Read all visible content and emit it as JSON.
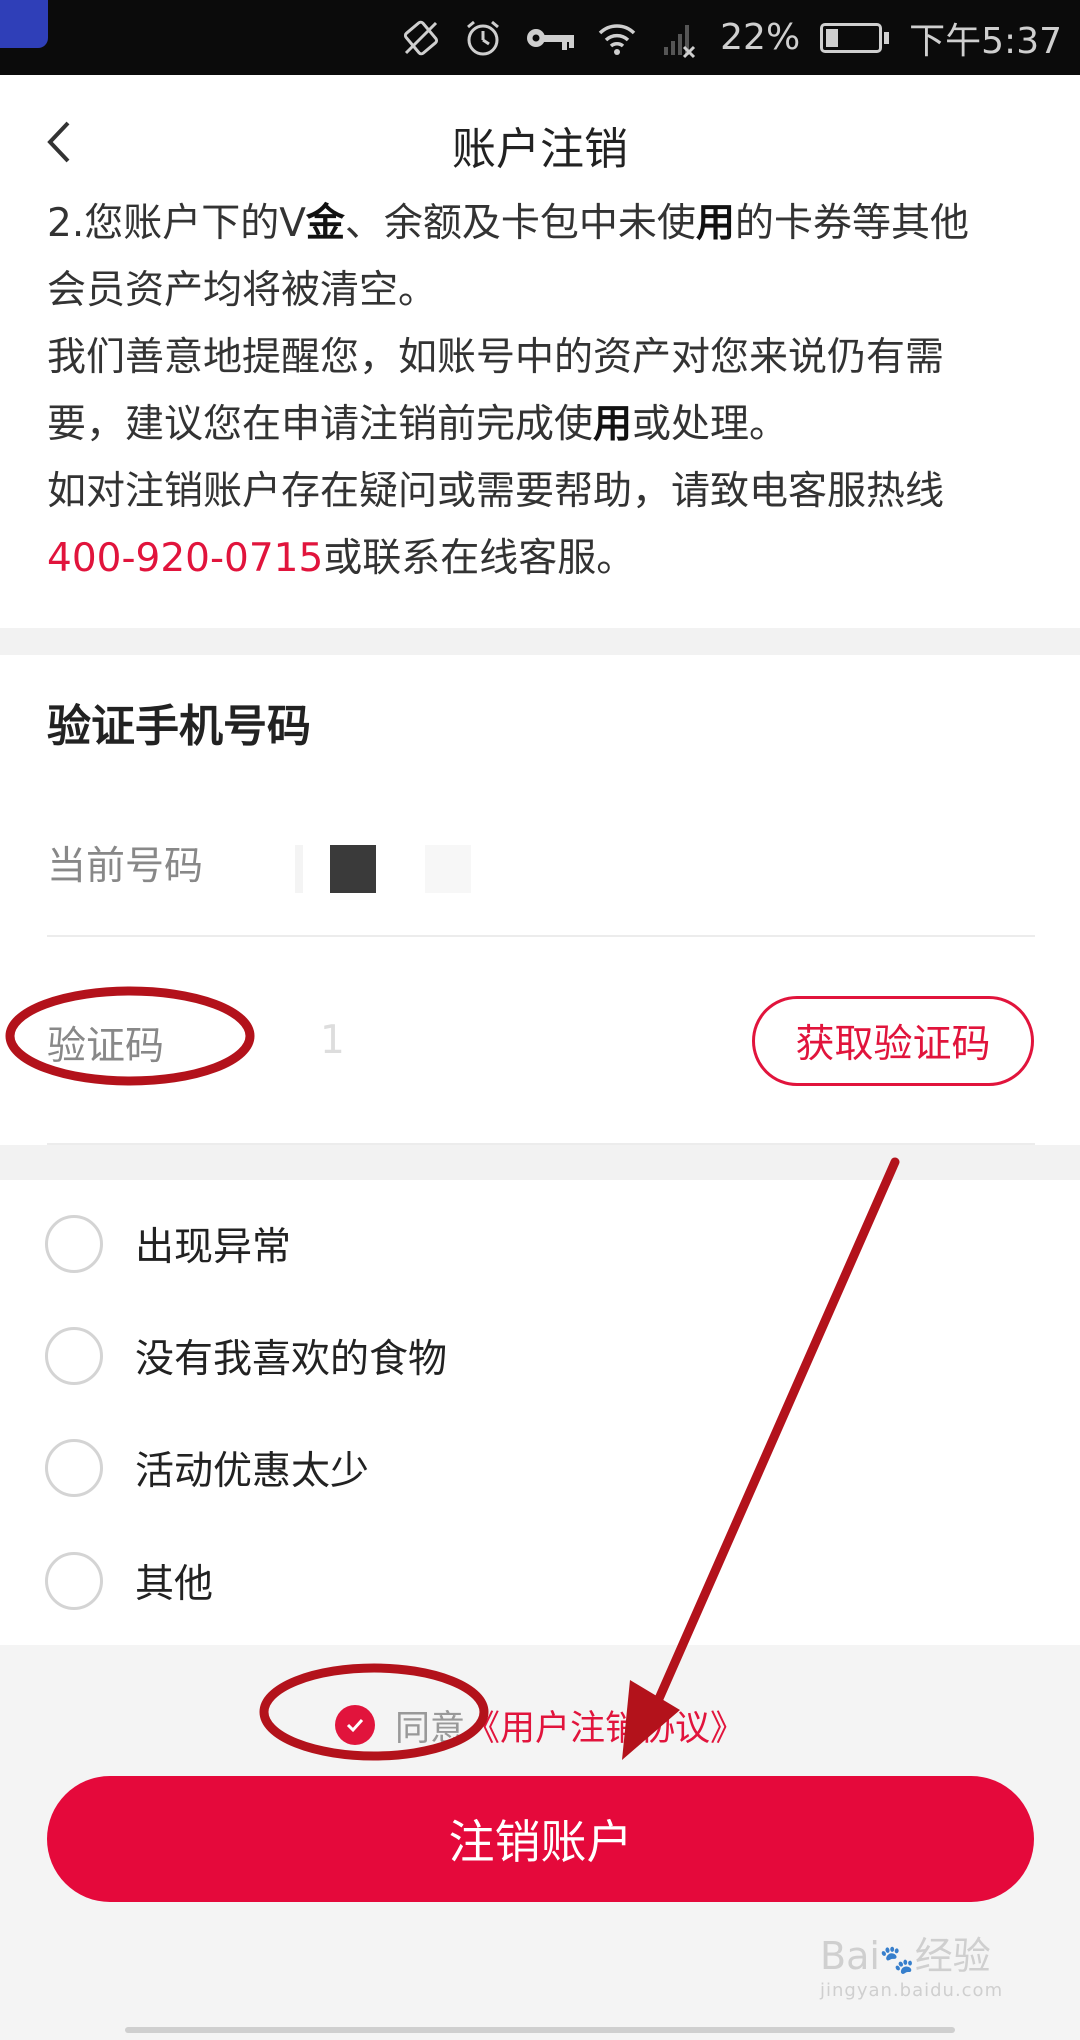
{
  "status_bar": {
    "battery": "22%",
    "time": "下午5:37",
    "icons": [
      "auto-rotate-icon",
      "alarm-icon",
      "key-icon",
      "wifi-icon",
      "signal-icon",
      "battery-icon"
    ]
  },
  "header": {
    "title": "账户注销",
    "back_icon": "chevron-left-icon"
  },
  "notice": {
    "line1_a": "2.您账户下的V",
    "line1_b": "金",
    "line1_c": "、余额及卡包中未使",
    "line1_d": "用",
    "line1_e": "的卡券等其他",
    "line2": "会员资产均将被清空。",
    "line3": "我们善意地提醒您，如账号中的资产对您来说仍有需",
    "line4_a": "要，建议您在申请注销前完成使",
    "line4_b": "用",
    "line4_c": "或处理。",
    "line5": "如对注销账户存在疑问或需要帮助，请致电客服热线",
    "hotline": "400-920-0715",
    "line6_tail": "或联系在线客服。"
  },
  "verify": {
    "title": "验证手机号码",
    "current_number_label": "当前号码",
    "code_label": "验证码",
    "code_value": "1",
    "get_code_button": "获取验证码"
  },
  "reasons": [
    {
      "label": "出现异常"
    },
    {
      "label": "没有我喜欢的食物"
    },
    {
      "label": "活动优惠太少"
    },
    {
      "label": "其他"
    }
  ],
  "agreement": {
    "agree_text": "同意",
    "link_text": "《用户注销协议》",
    "checked": true
  },
  "cancel_button": "注销账户",
  "watermark": {
    "brand": "Bai",
    "suffix": "经验",
    "url": "jingyan.baidu.com"
  },
  "colors": {
    "accent": "#e5093b",
    "annotation": "#b3121b"
  }
}
